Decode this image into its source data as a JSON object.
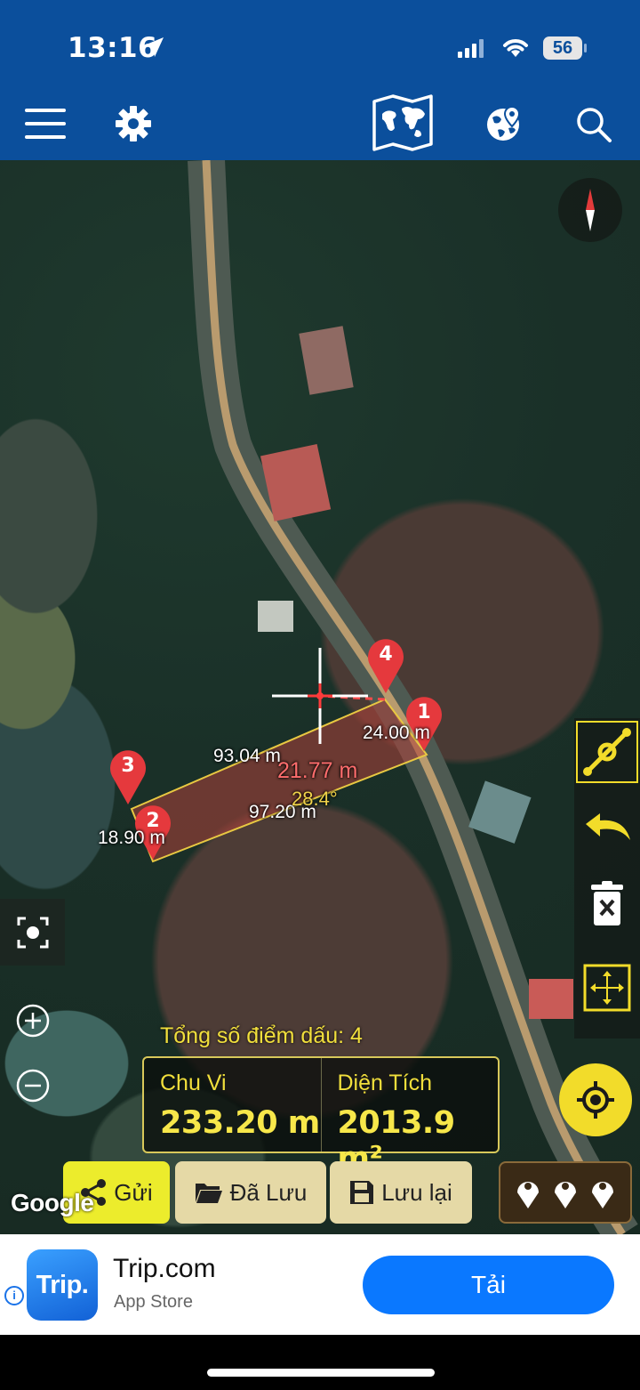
{
  "status_bar": {
    "time": "13:16",
    "battery": "56"
  },
  "nav_bar": {
    "icons": [
      "menu-icon",
      "gear-icon",
      "world-map-icon",
      "globe-pin-icon",
      "search-icon"
    ]
  },
  "map": {
    "markers": [
      {
        "label": "1"
      },
      {
        "label": "2"
      },
      {
        "label": "3"
      },
      {
        "label": "4"
      }
    ],
    "segment_labels": {
      "top": "93.04 m",
      "bottom": "97.20 m",
      "right": "24.00 m",
      "left": "18.90 m"
    },
    "cursor_distance": "21.77 m",
    "cursor_angle": "28.4°",
    "attribution": "Google",
    "colors": {
      "polygon_fill": "#b1423a",
      "polygon_edge": "#e8c842",
      "accent_yellow": "#f7e74a"
    }
  },
  "summary": {
    "points_count": "Tổng số điểm dấu: 4",
    "perimeter_label": "Chu Vi",
    "perimeter_value": "233.20 m",
    "area_label": "Diện Tích",
    "area_value": "2013.9 m²"
  },
  "actions": {
    "send": "Gửi",
    "saved": "Đã Lưu",
    "save": "Lưu lại"
  },
  "ad": {
    "logo": "Trip.",
    "name": "Trip.com",
    "store": "App Store",
    "cta": "Tải"
  }
}
